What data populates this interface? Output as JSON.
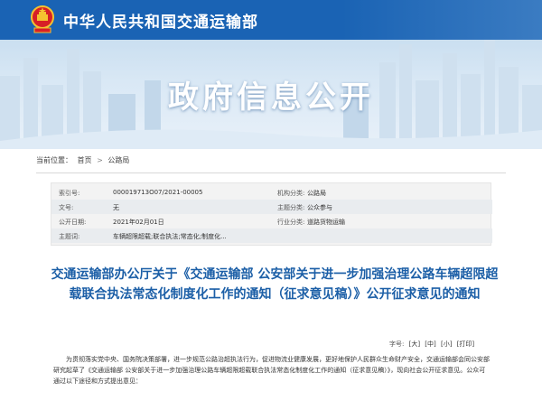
{
  "header": {
    "ministry": "中华人民共和国交通运输部",
    "banner_title": "政府信息公开"
  },
  "breadcrumb": {
    "label": "当前位置：",
    "items": [
      "首页",
      "公路局"
    ],
    "separator": ">"
  },
  "meta": {
    "rows": [
      {
        "label1": "索引号:",
        "value1": "000019713O07/2021-00005",
        "label2": "机构分类:",
        "value2": "公路局"
      },
      {
        "label1": "文号:",
        "value1": "无",
        "label2": "主题分类:",
        "value2": "公众参与"
      },
      {
        "label1": "公开日期:",
        "value1": "2021年02月01日",
        "label2": "行业分类:",
        "value2": "道路货物运输"
      },
      {
        "label1": "主题词:",
        "value1": "车辆超限超载;联合执法;常态化;制度化...",
        "label2": "",
        "value2": ""
      }
    ]
  },
  "article": {
    "title": "交通运输部办公厅关于《交通运输部 公安部关于进一步加强治理公路车辆超限超载联合执法常态化制度化工作的通知（征求意见稿）》公开征求意见的通知"
  },
  "tools": {
    "label": "字号:",
    "large": "[大]",
    "medium": "[中]",
    "small": "[小]",
    "print": "[打印]"
  },
  "body": {
    "p1": "为贯彻落实党中央、国务院决策部署，进一步规范公路治超执法行为，促进物流业健康发展，更好地保护人民群众生命财产安全，交通运输部会同公安部研究起草了《交通运输部 公安部关于进一步加强治理公路车辆超限超载联合执法常态化制度化工作的通知（征求意见稿）》，现向社会公开征求意见。公众可通过以下途径和方式提出意见："
  },
  "colors": {
    "topbar": "#1a63b4",
    "title_blue": "#1c5fa7",
    "emblem_red": "#d71f26",
    "emblem_gold": "#f4c230"
  },
  "icons": [
    "national-emblem-icon"
  ]
}
